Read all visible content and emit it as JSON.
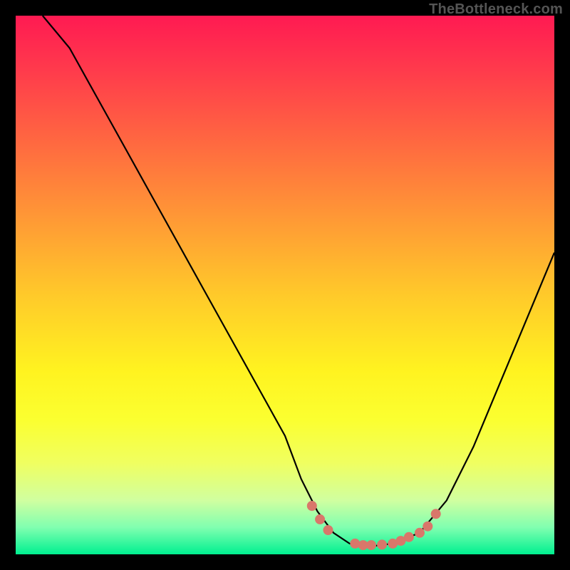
{
  "watermark": "TheBottleneck.com",
  "chart_data": {
    "type": "line",
    "title": "",
    "xlabel": "",
    "ylabel": "",
    "xlim": [
      0,
      100
    ],
    "ylim": [
      0,
      100
    ],
    "series": [
      {
        "name": "bottleneck-curve",
        "x": [
          5,
          10,
          15,
          20,
          25,
          30,
          35,
          40,
          45,
          50,
          53,
          56,
          59,
          62,
          64,
          66,
          70,
          75,
          80,
          85,
          90,
          95,
          100
        ],
        "y": [
          100,
          94,
          85,
          76,
          67,
          58,
          49,
          40,
          31,
          22,
          14,
          8,
          4,
          2,
          1.5,
          1.5,
          2,
          4,
          10,
          20,
          32,
          44,
          56
        ]
      }
    ],
    "markers": {
      "name": "optimal-range",
      "color": "#d9776a",
      "points": [
        {
          "x": 55,
          "y": 9
        },
        {
          "x": 56.5,
          "y": 6.5
        },
        {
          "x": 58,
          "y": 4.5
        },
        {
          "x": 63,
          "y": 2
        },
        {
          "x": 64.5,
          "y": 1.7
        },
        {
          "x": 66,
          "y": 1.7
        },
        {
          "x": 68,
          "y": 1.8
        },
        {
          "x": 70,
          "y": 2
        },
        {
          "x": 71.5,
          "y": 2.5
        },
        {
          "x": 73,
          "y": 3.2
        },
        {
          "x": 75,
          "y": 4
        },
        {
          "x": 76.5,
          "y": 5.2
        },
        {
          "x": 78,
          "y": 7.5
        }
      ]
    }
  }
}
